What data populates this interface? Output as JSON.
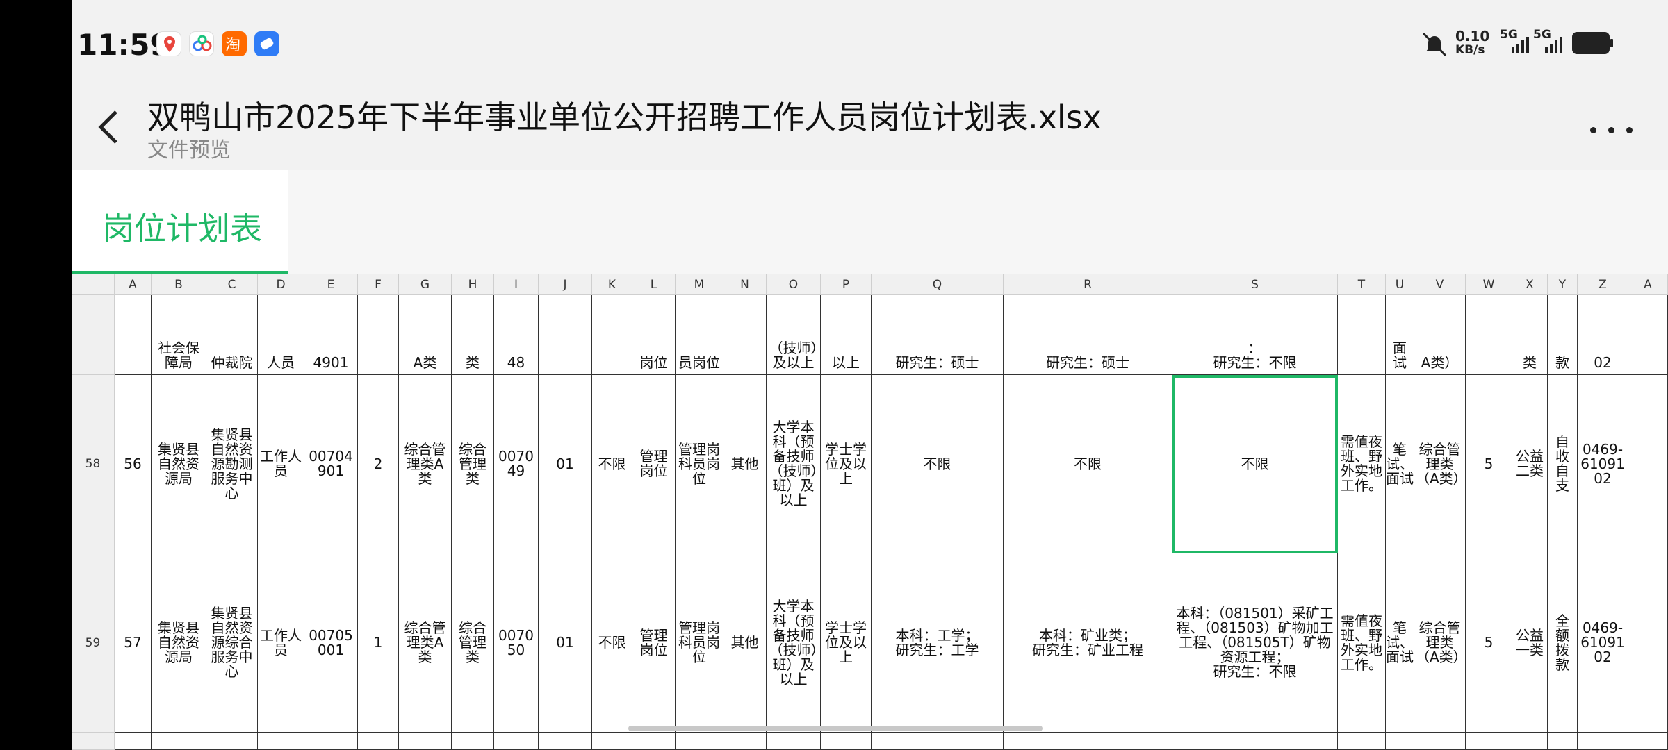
{
  "status_bar": {
    "time": "11:59",
    "net_speed_value": "0.10",
    "net_speed_unit": "KB/s",
    "sim1": "5G",
    "sim2": "5G",
    "icons": [
      "maps-app-icon",
      "baidu-netdisk-icon",
      "taobao-icon",
      "browser-app-icon",
      "mute-bell-icon",
      "signal-icon",
      "battery-icon"
    ],
    "app_colors": [
      "#e8453c",
      "#3a7bf5",
      "#ff6a00",
      "#2f7cf6"
    ]
  },
  "title_bar": {
    "title": "双鸭山市2025年下半年事业单位公开招聘工作人员岗位计划表.xlsx",
    "subtitle": "文件预览",
    "accent": "#1fb866"
  },
  "sheet": {
    "active_tab": "岗位计划表",
    "columns": [
      "A",
      "B",
      "C",
      "D",
      "E",
      "F",
      "G",
      "H",
      "I",
      "J",
      "K",
      "L",
      "M",
      "N",
      "O",
      "P",
      "Q",
      "R",
      "S",
      "T",
      "U",
      "V",
      "W",
      "X",
      "Y",
      "Z",
      "A"
    ],
    "rows": [
      {
        "num": "",
        "cells": [
          "",
          "社会保障局",
          "仲裁院",
          "人员",
          "4901",
          "",
          "A类",
          "类",
          "48",
          "",
          "",
          "岗位",
          "员岗位",
          "",
          "（技师）及以上",
          "以上",
          "研究生：硕士",
          "研究生：硕士",
          "：\n研究生：不限",
          "",
          "面试",
          "A类）",
          "",
          "类",
          "款",
          "02",
          ""
        ]
      },
      {
        "num": "58",
        "cells": [
          "56",
          "集贤县自然资源局",
          "集贤县自然资源勘测服务中心",
          "工作人员",
          "00704901",
          "2",
          "综合管理类A类",
          "综合管理类",
          "007049",
          "01",
          "不限",
          "管理岗位",
          "管理岗科员岗位",
          "其他",
          "大学本科（预备技师（技师）班）及以上",
          "学士学位及以上",
          "不限",
          "不限",
          "不限",
          "需值夜班、野外实地工作。",
          "笔试、面试",
          "综合管理类（A类）",
          "5",
          "公益二类",
          "自收自支",
          "0469-6109102",
          ""
        ]
      },
      {
        "num": "59",
        "cells": [
          "57",
          "集贤县自然资源局",
          "集贤县自然资源综合服务中心",
          "工作人员",
          "00705001",
          "1",
          "综合管理类A类",
          "综合管理类",
          "007050",
          "01",
          "不限",
          "管理岗位",
          "管理岗科员岗位",
          "其他",
          "大学本科（预备技师（技师）班）及以上",
          "学士学位及以上",
          "本科：工学；\n研究生：工学",
          "本科：矿业类；\n研究生：矿业工程",
          "本科：（081501）采矿工程、（081503）矿物加工工程、（081505T）矿物资源工程；\n研究生：不限",
          "需值夜班、野外实地工作。",
          "笔试、面试",
          "综合管理类（A类）",
          "5",
          "公益一类",
          "全额拨款",
          "0469-6109102",
          ""
        ]
      },
      {
        "num": "",
        "cells": [
          "",
          "",
          "",
          "",
          "",
          "",
          "",
          "",
          "",
          "",
          "",
          "",
          "",
          "",
          "",
          "",
          "",
          "",
          "",
          "",
          "",
          "",
          "",
          "",
          "",
          "",
          ""
        ]
      }
    ]
  }
}
